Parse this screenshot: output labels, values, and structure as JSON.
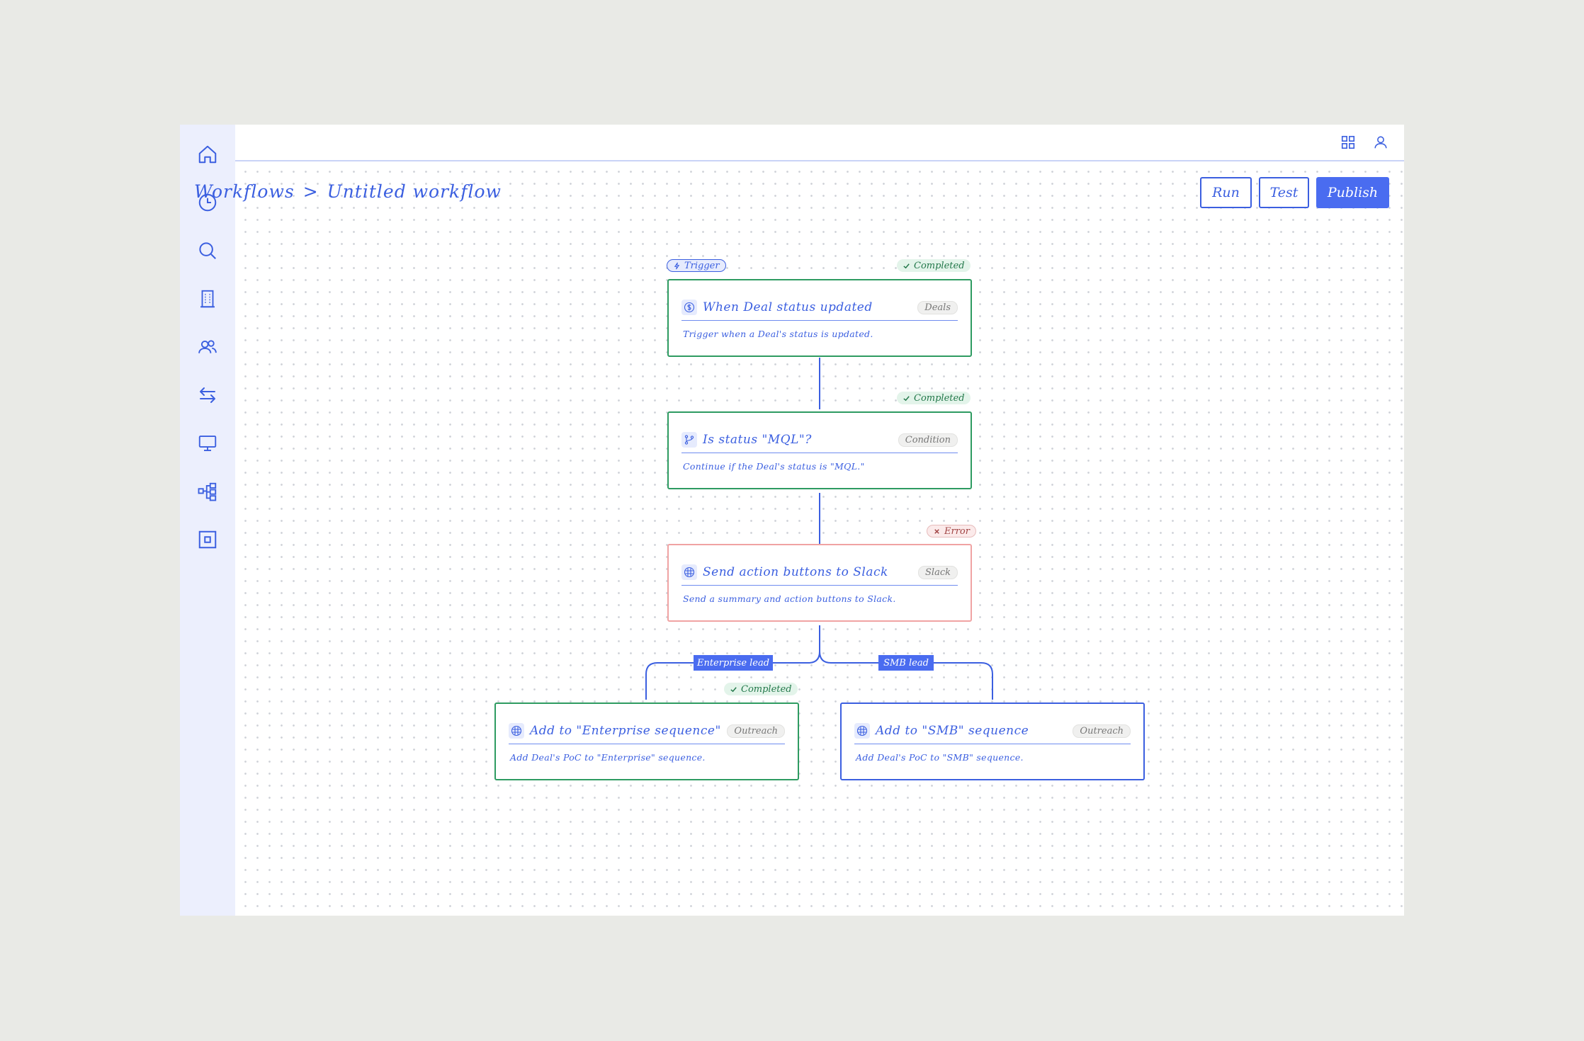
{
  "sidebar": {
    "items": [
      {
        "icon": "home-icon"
      },
      {
        "icon": "clock-icon"
      },
      {
        "icon": "search-icon"
      },
      {
        "icon": "building-icon"
      },
      {
        "icon": "users-icon"
      },
      {
        "icon": "arrows-swap-icon"
      },
      {
        "icon": "monitor-icon"
      },
      {
        "icon": "workflow-tree-icon"
      },
      {
        "icon": "square-target-icon"
      }
    ]
  },
  "topbar": {
    "icons": [
      "grid-icon",
      "user-icon"
    ]
  },
  "breadcrumb": {
    "parent": "Workflows",
    "separator": ">",
    "current": "Untitled workflow"
  },
  "toolbar": {
    "run_label": "Run",
    "test_label": "Test",
    "publish_label": "Publish"
  },
  "colors": {
    "accent": "#4a6cf0",
    "completed": "#2e9b61",
    "error": "#f0a3a3",
    "sidebar_bg": "#eceffd"
  },
  "workflow": {
    "trigger_badge": "Trigger",
    "nodes": [
      {
        "title": "When Deal status updated",
        "tag": "Deals",
        "description": "Trigger when a Deal's status is updated.",
        "status": "Completed",
        "icon": "dollar-icon"
      },
      {
        "title": "Is status \"MQL\"?",
        "tag": "Condition",
        "description": "Continue if the Deal's status is \"MQL.\"",
        "status": "Completed",
        "icon": "branch-icon"
      },
      {
        "title": "Send action buttons to Slack",
        "tag": "Slack",
        "description": "Send a summary and action buttons to Slack.",
        "status": "Error",
        "icon": "slack-icon"
      },
      {
        "title": "Add to \"Enterprise sequence\"",
        "tag": "Outreach",
        "description": "Add Deal's PoC to \"Enterprise\" sequence.",
        "status": "Completed",
        "icon": "outreach-icon"
      },
      {
        "title": "Add to \"SMB\" sequence",
        "tag": "Outreach",
        "description": "Add Deal's PoC to \"SMB\" sequence.",
        "icon": "outreach-icon"
      }
    ],
    "branches": [
      "Enterprise lead",
      "SMB lead"
    ]
  }
}
